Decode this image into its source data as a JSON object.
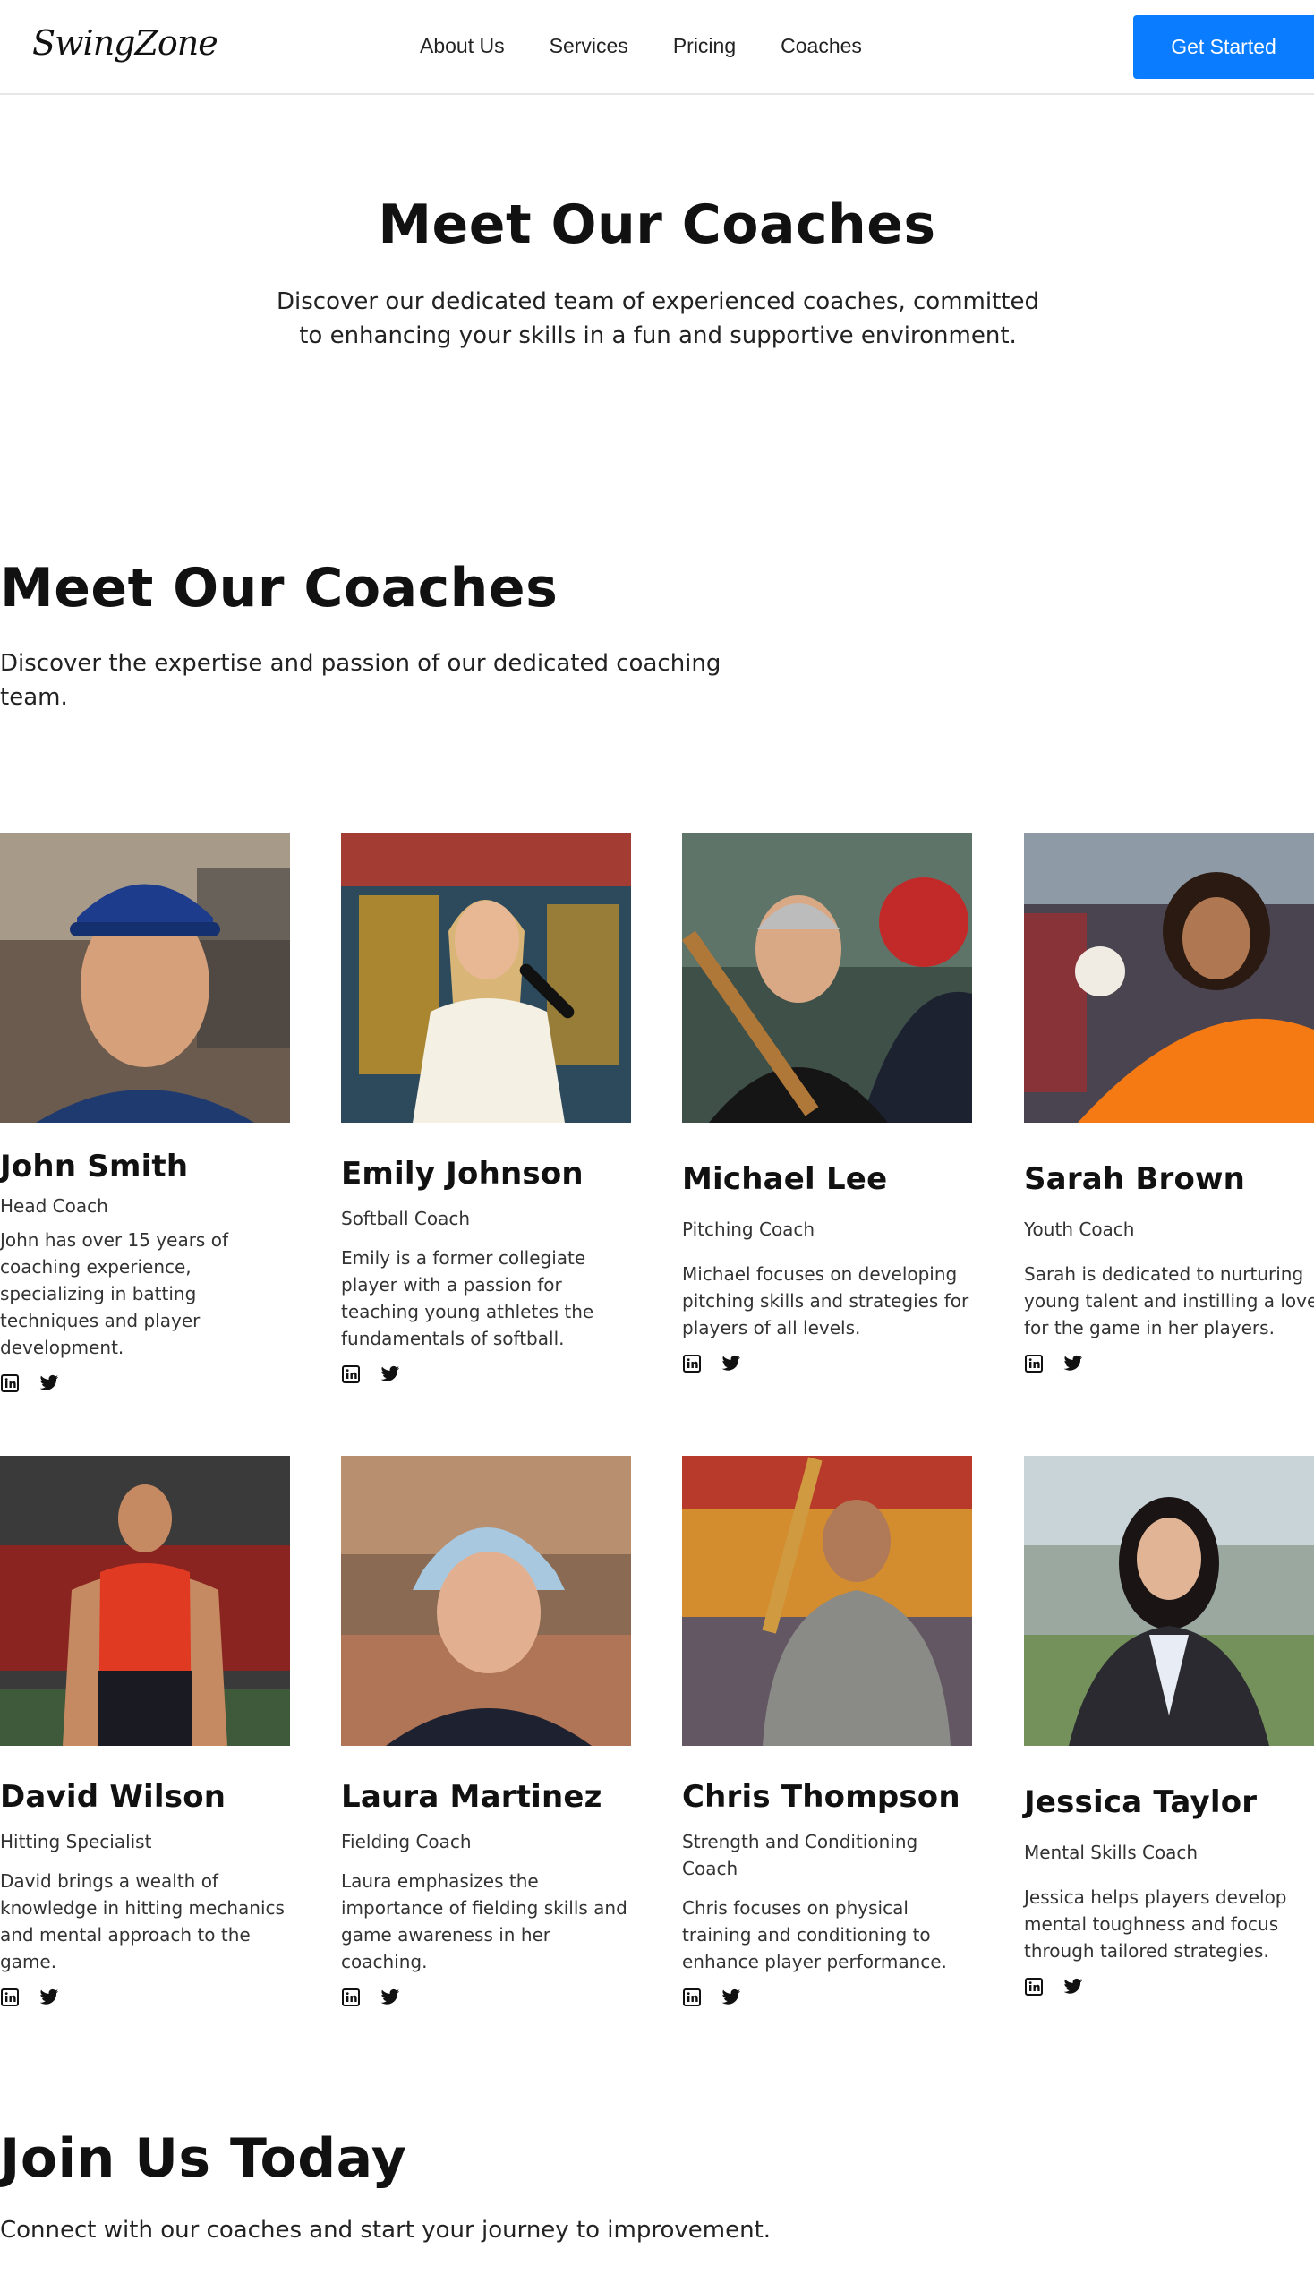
{
  "header": {
    "logo": "SwingZone",
    "nav": [
      "About Us",
      "Services",
      "Pricing",
      "Coaches"
    ],
    "cta_label": "Get Started",
    "cta_color": "#0a7cff"
  },
  "hero": {
    "title": "Meet Our Coaches",
    "subtitle": "Discover our dedicated team of experienced coaches, committed to enhancing your skills in a fun and supportive environment."
  },
  "section": {
    "title": "Meet Our Coaches",
    "subtitle": "Discover the expertise and passion of our dedicated coaching team."
  },
  "coaches": [
    {
      "name": "John Smith",
      "role": "Head Coach",
      "bio": "John has over 15 years of coaching experience, specializing in batting techniques and player development."
    },
    {
      "name": "Emily Johnson",
      "role": "Softball Coach",
      "bio": "Emily is a former collegiate player with a passion for teaching young athletes the fundamentals of softball."
    },
    {
      "name": "Michael Lee",
      "role": "Pitching Coach",
      "bio": "Michael focuses on developing pitching skills and strategies for players of all levels."
    },
    {
      "name": "Sarah Brown",
      "role": "Youth Coach",
      "bio": "Sarah is dedicated to nurturing young talent and instilling a love for the game in her players."
    },
    {
      "name": "David Wilson",
      "role": "Hitting Specialist",
      "bio": "David brings a wealth of knowledge in hitting mechanics and mental approach to the game."
    },
    {
      "name": "Laura Martinez",
      "role": "Fielding Coach",
      "bio": "Laura emphasizes the importance of fielding skills and game awareness in her coaching."
    },
    {
      "name": "Chris Thompson",
      "role": "Strength and Conditioning Coach",
      "bio": "Chris focuses on physical training and conditioning to enhance player performance."
    },
    {
      "name": "Jessica Taylor",
      "role": "Mental Skills Coach",
      "bio": "Jessica helps players develop mental toughness and focus through tailored strategies."
    }
  ],
  "social_icons": [
    "linkedin-icon",
    "twitter-icon"
  ],
  "join": {
    "title": "Join Us Today",
    "subtitle": "Connect with our coaches and start your journey to improvement."
  }
}
